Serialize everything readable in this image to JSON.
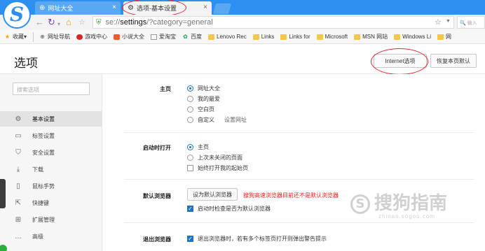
{
  "tabs": [
    {
      "label": "网址大全",
      "icon": "globe-icon"
    },
    {
      "label": "选项-基本设置",
      "icon": "gear-icon"
    }
  ],
  "address": {
    "url_prefix": "se://",
    "url_host": "settings",
    "url_rest": "/?category=general",
    "search_placeholder": "输入"
  },
  "bookmarks": [
    {
      "label": "收藏",
      "icon": "star"
    },
    {
      "label": "网址导航",
      "icon": "globe"
    },
    {
      "label": "游戏中心",
      "icon": "red"
    },
    {
      "label": "小说大全",
      "icon": "orange"
    },
    {
      "label": "爱淘宝",
      "icon": "page"
    },
    {
      "label": "百度",
      "icon": "green"
    },
    {
      "label": "Lenovo Rec",
      "icon": "folder"
    },
    {
      "label": "Links",
      "icon": "folder"
    },
    {
      "label": "Links for",
      "icon": "folder"
    },
    {
      "label": "Microsoft",
      "icon": "folder"
    },
    {
      "label": "MSN 网站",
      "icon": "folder"
    },
    {
      "label": "Windows Li",
      "icon": "folder"
    },
    {
      "label": "网",
      "icon": "folder"
    }
  ],
  "header": {
    "title": "选项",
    "internet_btn": "Internet选项",
    "restore_btn": "恢复本页默认"
  },
  "sidebar": {
    "search_placeholder": "搜索选项",
    "items": [
      {
        "label": "基本设置",
        "icon": "gear-icon"
      },
      {
        "label": "标签设置",
        "icon": "tab-icon"
      },
      {
        "label": "安全设置",
        "icon": "shield-icon"
      },
      {
        "label": "下载",
        "icon": "download-icon"
      },
      {
        "label": "鼠标手势",
        "icon": "mouse-icon"
      },
      {
        "label": "快捷键",
        "icon": "shortcut-icon"
      },
      {
        "label": "扩展管理",
        "icon": "extension-icon"
      },
      {
        "label": "高级",
        "icon": "more-icon"
      }
    ]
  },
  "homepage": {
    "label": "主页",
    "options": [
      "网址大全",
      "我的最爱",
      "空白页",
      "自定义"
    ],
    "set_url": "设置网址"
  },
  "startup": {
    "label": "启动时打开",
    "options": [
      "主页",
      "上次未关闭的页面"
    ],
    "checkbox": "始终打开我的起始页"
  },
  "default_browser": {
    "label": "默认浏览器",
    "button": "设为默认浏览器",
    "warning": "搜狗高速浏览器目前还不是默认浏览器",
    "checkbox": "启动时检查是否为默认浏览器"
  },
  "exit": {
    "label": "退出浏览器",
    "checkbox": "退出浏览器时，若有多个标签页打开则弹出警告提示"
  },
  "watermark": {
    "text": "搜狗指南",
    "sub": "zhinan.sogou.com"
  },
  "colors": {
    "accent": "#2d8ff0",
    "warning": "#e02020",
    "annotation": "#dd2233"
  }
}
